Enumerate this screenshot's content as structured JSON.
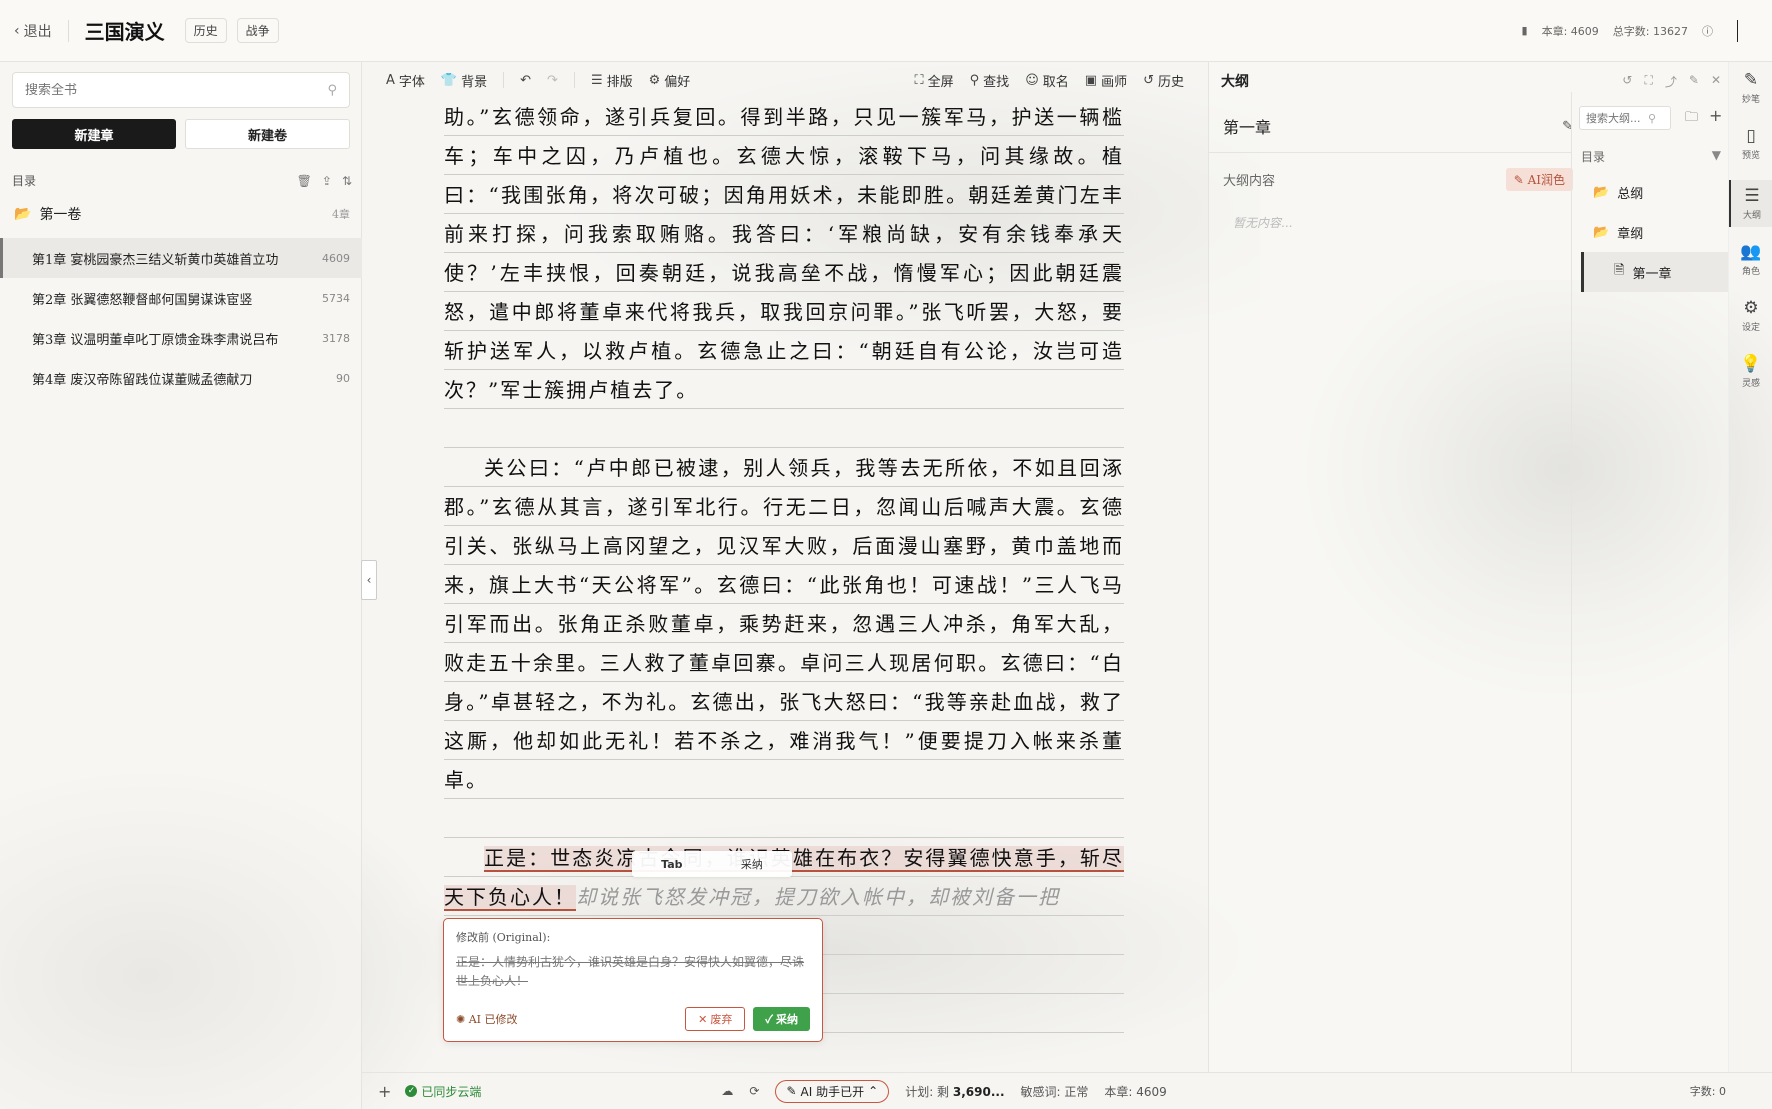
{
  "topbar": {
    "back_label": "退出",
    "book_title": "三国演义",
    "tags": [
      "历史",
      "战争"
    ],
    "chapter_words": "本章: 4609",
    "total_words": "总字数: 13627"
  },
  "sidebar": {
    "search_placeholder": "搜索全书",
    "new_chapter": "新建章",
    "new_volume": "新建卷",
    "toc_label": "目录",
    "volume": {
      "name": "第一卷",
      "count": "4章"
    },
    "chapters": [
      {
        "title": "第1章 宴桃园豪杰三结义斩黄巾英雄首立功",
        "count": "4609",
        "active": true
      },
      {
        "title": "第2章 张翼德怒鞭督邮何国舅谋诛宦竖",
        "count": "5734",
        "active": false
      },
      {
        "title": "第3章 议温明董卓叱丁原馈金珠李肃说吕布",
        "count": "3178",
        "active": false
      },
      {
        "title": "第4章 废汉帝陈留践位谋董贼孟德献刀",
        "count": "90",
        "active": false
      }
    ]
  },
  "toolbar": {
    "font": "字体",
    "background": "背景",
    "layout": "排版",
    "prefs": "偏好",
    "fullscreen": "全屏",
    "find": "查找",
    "naming": "取名",
    "painter": "画师",
    "history": "历史"
  },
  "editor": {
    "p1": "助。”玄德领命，遂引兵复回。得到半路，只见一簇军马，护送一辆槛车；车中之囚，乃卢植也。玄德大惊，滚鞍下马，问其缘故。植曰：“我围张角，将次可破；因角用妖术，未能即胜。朝廷差黄门左丰前来打探，问我索取贿赂。我答曰：‘军粮尚缺，安有余钱奉承天使？’左丰挟恨，回奏朝廷，说我高垒不战，惰慢军心；因此朝廷震怒，遣中郎将董卓来代将我兵，取我回京问罪。”张飞听罢，大怒，要斩护送军人，以救卢植。玄德急止之曰：“朝廷自有公论，汝岂可造次？”军士簇拥卢植去了。",
    "p2": "关公曰：“卢中郎已被逮，别人领兵，我等去无所依，不如且回涿郡。”玄德从其言，遂引军北行。行无二日，忽闻山后喊声大震。玄德引关、张纵马上高冈望之，见汉军大败，后面漫山塞野，黄巾盖地而来，旗上大书“天公将军”。玄德曰：“此张角也！可速战！”三人飞马引军而出。张角正杀败董卓，乘势赶来，忽遇三人冲杀，角军大乱，败走五十余里。三人救了董卓回寨。卓问三人现居何职。玄德曰：“白身。”卓甚轻之，不为礼。玄德出，张飞大怒曰：“我等亲赴血战，救了这厮，他却如此无礼！若不杀之，难消我气！”便要提刀入帐来杀董卓。",
    "p3_highlight": "正是：世态炎凉古今同，谁识英雄在布衣？安得翼德快意手，斩尽天下负心人！",
    "p3_ghost": "却说张飞怒发冲冠，提刀欲入帐中，却被刘备一把"
  },
  "tab_hint": {
    "key": "Tab",
    "action": "采纳"
  },
  "diff_popup": {
    "label": "修改前 (Original):",
    "original": "正是：人情势利古犹今，谁识英雄是白身？安得快人如翼德，尽诛世上负心人！",
    "ai_label": "AI 已修改",
    "discard": "✕ 废弃",
    "adopt": "✓ 采纳"
  },
  "statusbar": {
    "synced": "已同步云端",
    "ai_assistant": "AI 助手已开",
    "plan_label": "计划: 剩",
    "plan_value": "3,690...",
    "sensitive": "敏感词: 正常",
    "chapter": "本章: 4609",
    "words": "字数: 0"
  },
  "outline": {
    "title": "大纲",
    "chapter_title": "第一章",
    "content_label": "大纲内容",
    "ai_polish": "AI润色",
    "empty": "暂无内容...",
    "search_placeholder": "搜索大纲...",
    "toc_label": "目录",
    "nodes": [
      {
        "label": "总纲"
      },
      {
        "label": "章纲"
      },
      {
        "label": "第一章"
      }
    ]
  },
  "rail": [
    {
      "label": "妙笔",
      "icon": "magic-wand-icon"
    },
    {
      "label": "预览",
      "icon": "phone-icon"
    },
    {
      "label": "大纲",
      "icon": "list-icon"
    },
    {
      "label": "角色",
      "icon": "users-icon"
    },
    {
      "label": "设定",
      "icon": "gear-icon"
    },
    {
      "label": "灵感",
      "icon": "bulb-icon"
    }
  ]
}
